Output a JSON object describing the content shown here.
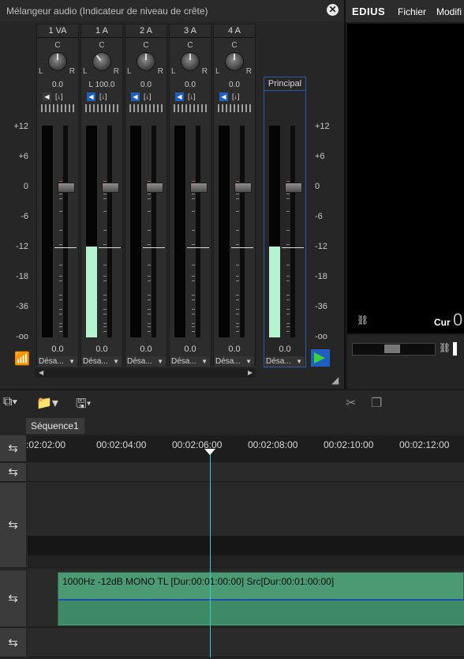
{
  "mixer": {
    "title": "Mélangeur audio (Indicateur de niveau de crête)",
    "close_glyph": "✕",
    "scale": [
      "+12",
      "+6",
      "0",
      "-6",
      "-12",
      "-18",
      "-36",
      "-oo"
    ],
    "channels": [
      {
        "name": "1 VA",
        "c": "C",
        "l": "L",
        "r": "R",
        "pan": "0.0",
        "speaker_on": false,
        "volume": "0.0",
        "output": "Désa...",
        "meter_level": 0
      },
      {
        "name": "1 A",
        "c": "C",
        "l": "L",
        "r": "R",
        "pan": "L 100.0",
        "speaker_on": true,
        "volume": "0.0",
        "output": "Désa...",
        "meter_level": 0.43
      },
      {
        "name": "2 A",
        "c": "C",
        "l": "L",
        "r": "R",
        "pan": "0.0",
        "speaker_on": true,
        "volume": "0.0",
        "output": "Désa...",
        "meter_level": 0
      },
      {
        "name": "3 A",
        "c": "C",
        "l": "L",
        "r": "R",
        "pan": "0.0",
        "speaker_on": true,
        "volume": "0.0",
        "output": "Désa...",
        "meter_level": 0
      },
      {
        "name": "4 A",
        "c": "C",
        "l": "L",
        "r": "R",
        "pan": "0.0",
        "speaker_on": true,
        "volume": "0.0",
        "output": "Désa...",
        "meter_level": 0
      }
    ],
    "master": {
      "name": "Principal",
      "volume": "0.0",
      "output": "Désa...",
      "meter_level": 0.43
    },
    "channel_icon_label": "[↓]",
    "colors": {
      "meter_fill": "#b6f3d3",
      "accent_blue": "#1f5fbf",
      "play_green": "#3bd13b"
    }
  },
  "edius": {
    "logo": "EDIUS",
    "menu": [
      "Fichier",
      "Modifi"
    ],
    "cur_label": "Cur",
    "cur_value": "0"
  },
  "timeline": {
    "sequence_tab": "Séquence1",
    "timecodes": [
      ":02:02:00",
      "00:02:04:00",
      "00:02:06:00",
      "00:02:08:00",
      "00:02:10:00",
      "00:02:12:00"
    ],
    "clip_label": "1000Hz -12dB MONO   TL [Dur:00:01:00:00]   Src[Dur:00:01:00:00]",
    "track_icon": "⇆",
    "colors": {
      "clip": "#4b9a74",
      "playhead": "#2fd0c8"
    }
  }
}
